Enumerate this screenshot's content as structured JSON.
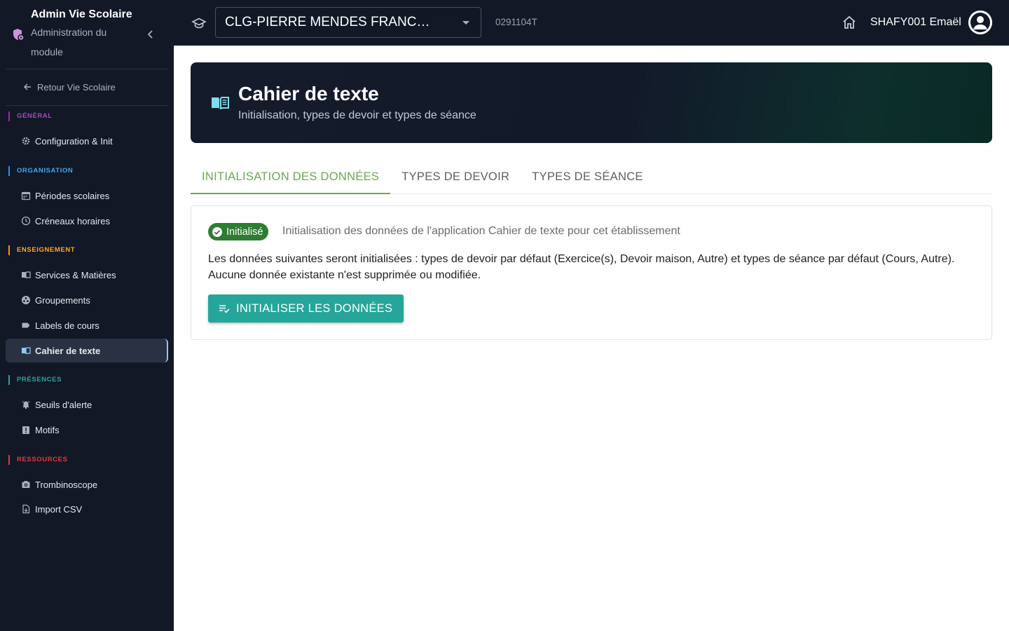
{
  "sidebar": {
    "title": "Admin Vie Scolaire",
    "subtitle": "Administration du module",
    "back_label": "Retour Vie Scolaire",
    "sections": [
      {
        "label": "GÉNÉRAL",
        "color": "#9c27b0",
        "items": [
          {
            "label": "Configuration & Init",
            "icon": "gear-icon"
          }
        ]
      },
      {
        "label": "ORGANISATION",
        "color": "#2196f3",
        "items": [
          {
            "label": "Périodes scolaires",
            "icon": "calendar-icon"
          },
          {
            "label": "Créneaux horaires",
            "icon": "clock-icon"
          }
        ]
      },
      {
        "label": "ENSEIGNEMENT",
        "color": "#ff9800",
        "items": [
          {
            "label": "Services & Matières",
            "icon": "book-icon"
          },
          {
            "label": "Groupements",
            "icon": "group-icon"
          },
          {
            "label": "Labels de cours",
            "icon": "label-icon"
          },
          {
            "label": "Cahier de texte",
            "icon": "open-book-icon",
            "active": true
          }
        ]
      },
      {
        "label": "PRÉSENCES",
        "color": "#26a69a",
        "items": [
          {
            "label": "Seuils d'alerte",
            "icon": "alarm-icon"
          },
          {
            "label": "Motifs",
            "icon": "report-icon"
          }
        ]
      },
      {
        "label": "RESSOURCES",
        "color": "#e53935",
        "items": [
          {
            "label": "Trombinoscope",
            "icon": "camera-icon"
          },
          {
            "label": "Import CSV",
            "icon": "file-import-icon"
          }
        ]
      }
    ]
  },
  "topbar": {
    "school_name": "CLG-PIERRE MENDES FRANC…",
    "uai": "0291104T",
    "user_name": "SHAFY001 Emaël"
  },
  "hero": {
    "title": "Cahier de texte",
    "subtitle": "Initialisation, types de devoir et types de séance"
  },
  "tabs": [
    {
      "label": "INITIALISATION DES DONNÉES",
      "active": true
    },
    {
      "label": "TYPES DE DEVOIR",
      "active": false
    },
    {
      "label": "TYPES DE SÉANCE",
      "active": false
    }
  ],
  "card": {
    "status_label": "Initialisé",
    "description": "Initialisation des données de l'application Cahier de texte pour cet établissement",
    "text_line1": "Les données suivantes seront initialisées : types de devoir par défaut (Exercice(s), Devoir maison, Autre) et types de séance par défaut (Cours, Autre).",
    "text_line2": "Aucune donnée existante n'est supprimée ou modifiée.",
    "button_label": "INITIALISER LES DONNÉES"
  },
  "colors": {
    "sidebar_bg": "#121826",
    "accent_green": "#6aa84f",
    "button_teal": "#26a69a",
    "chip_green": "#2e7d32"
  }
}
